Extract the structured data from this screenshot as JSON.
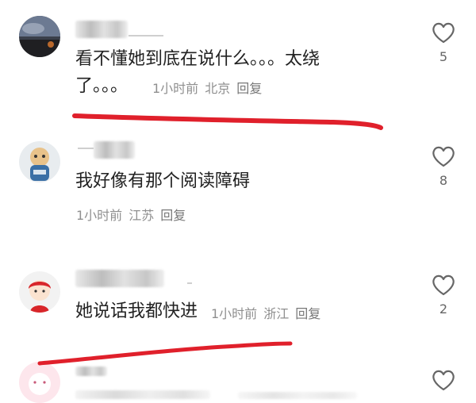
{
  "comments": [
    {
      "text_line1": "看不懂她到底在说什么。。。太绕",
      "text_line2": "了。。。",
      "time": "1小时前",
      "location": "北京",
      "reply": "回复",
      "likes": "5"
    },
    {
      "text_line1": "我好像有那个阅读障碍",
      "time": "1小时前",
      "location": "江苏",
      "reply": "回复",
      "likes": "8"
    },
    {
      "text_line1": "她说话我都快进",
      "time": "1小时前",
      "location": "浙江",
      "reply": "回复",
      "likes": "2"
    },
    {
      "text_line1": "",
      "likes": ""
    }
  ],
  "icons": {
    "like": "heart-outline-icon"
  },
  "colors": {
    "annotation_red": "#e0202b",
    "meta_gray": "#8f8f8f"
  }
}
